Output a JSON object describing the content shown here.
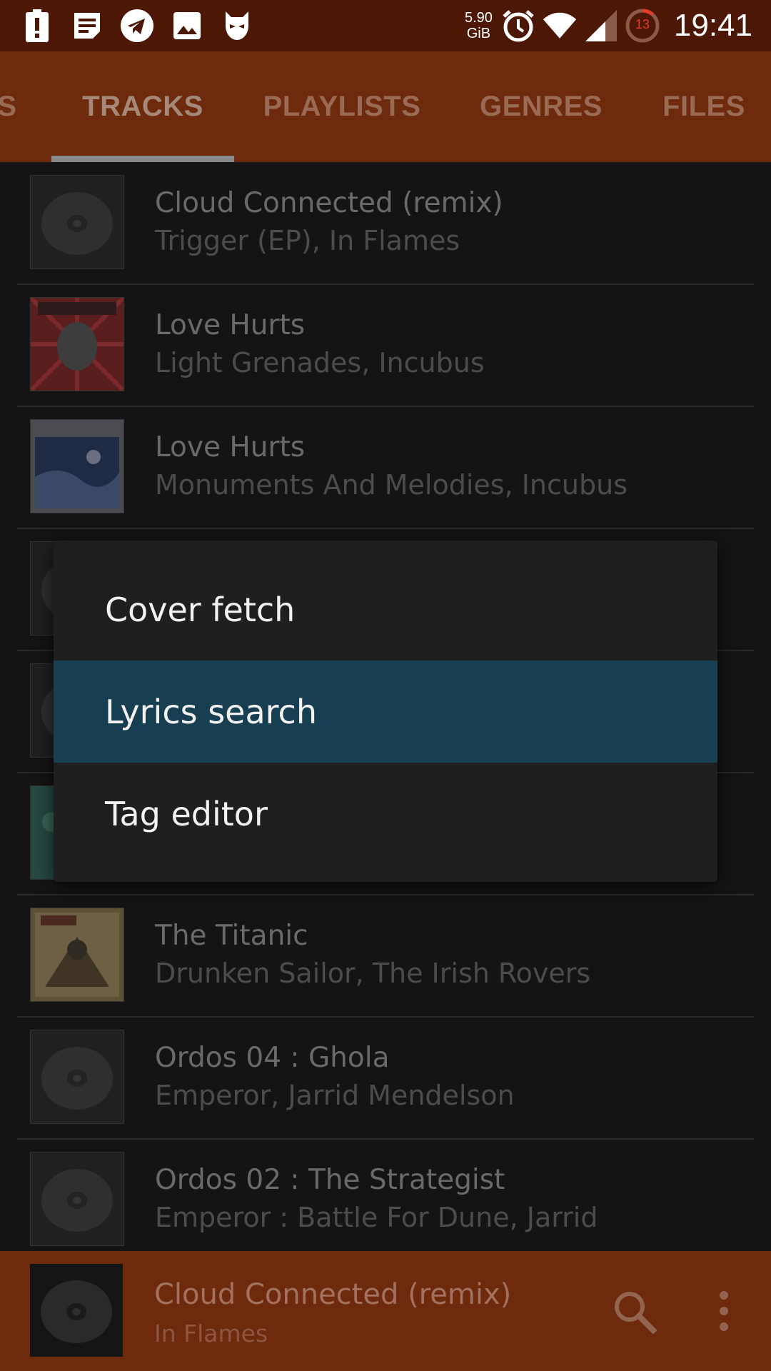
{
  "status_bar": {
    "net_speed_value": "5.90",
    "net_speed_unit": "GiB",
    "notification_count": "13",
    "time": "19:41",
    "icons": [
      "alert-icon",
      "notes-icon",
      "telegram-icon",
      "image-icon",
      "cat-icon",
      "alarm-icon",
      "wifi-icon",
      "signal-icon",
      "battery-icon"
    ]
  },
  "tabs": [
    {
      "label": "S",
      "active": false
    },
    {
      "label": "TRACKS",
      "active": true
    },
    {
      "label": "PLAYLISTS",
      "active": false
    },
    {
      "label": "GENRES",
      "active": false
    },
    {
      "label": "FILES",
      "active": false
    }
  ],
  "tracks": [
    {
      "title": "Cloud Connected (remix)",
      "subtitle": "Trigger (EP), In Flames",
      "cover": "disc"
    },
    {
      "title": "Love Hurts",
      "subtitle": "Light Grenades, Incubus",
      "cover": "art-red"
    },
    {
      "title": "Love Hurts",
      "subtitle": "Monuments And Melodies, Incubus",
      "cover": "art-blue"
    },
    {
      "title": "",
      "subtitle": "",
      "cover": "disc"
    },
    {
      "title": "",
      "subtitle": "",
      "cover": "disc"
    },
    {
      "title": "",
      "subtitle": "",
      "cover": "art-teal"
    },
    {
      "title": "The Titanic",
      "subtitle": "Drunken Sailor, The Irish Rovers",
      "cover": "art-brown"
    },
    {
      "title": "Ordos 04 : Ghola",
      "subtitle": "Emperor, Jarrid Mendelson",
      "cover": "disc"
    },
    {
      "title": "Ordos 02 : The Strategist",
      "subtitle": "Emperor : Battle For Dune, Jarrid",
      "cover": "disc"
    }
  ],
  "context_menu": {
    "items": [
      {
        "label": "Cover fetch",
        "selected": false
      },
      {
        "label": "Lyrics search",
        "selected": true
      },
      {
        "label": "Tag editor",
        "selected": false
      }
    ]
  },
  "now_playing": {
    "title": "Cloud Connected (remix)",
    "artist": "In Flames"
  },
  "colors": {
    "status_bar": "#4d1706",
    "accent": "#6d2a0d",
    "menu_selected": "#173e51",
    "menu_bg": "#1f1f1f"
  }
}
